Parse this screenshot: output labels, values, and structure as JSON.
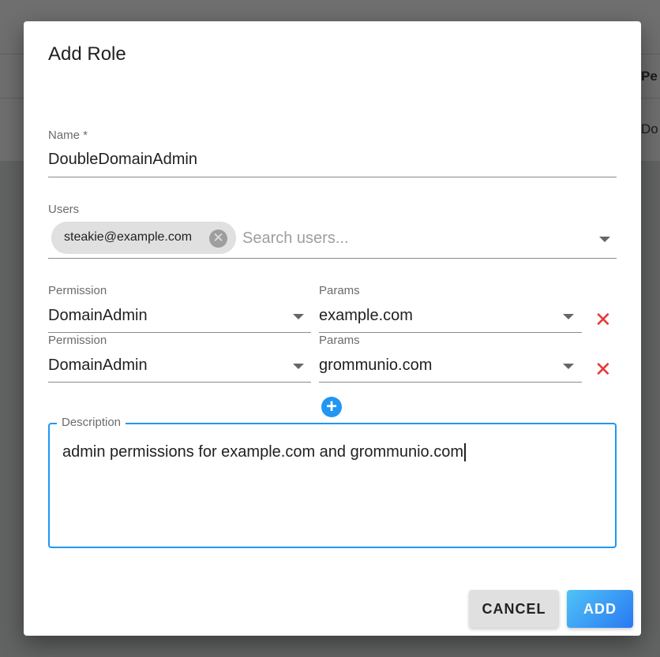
{
  "background": {
    "header_partial": "Pe",
    "row_partial": "Do"
  },
  "dialog": {
    "title": "Add Role",
    "name": {
      "label": "Name *",
      "value": "DoubleDomainAdmin"
    },
    "users": {
      "label": "Users",
      "chips": [
        "steakie@example.com"
      ],
      "placeholder": "Search users..."
    },
    "permissions": [
      {
        "permission_label": "Permission",
        "permission": "DomainAdmin",
        "params_label": "Params",
        "params": "example.com"
      },
      {
        "permission_label": "Permission",
        "permission": "DomainAdmin",
        "params_label": "Params",
        "params": "grommunio.com"
      }
    ],
    "description": {
      "label": "Description",
      "value": "admin permissions for example.com and grommunio.com"
    },
    "buttons": {
      "cancel": "CANCEL",
      "add": "ADD"
    }
  },
  "colors": {
    "accent": "#2196f3",
    "delete": "#e53935"
  }
}
